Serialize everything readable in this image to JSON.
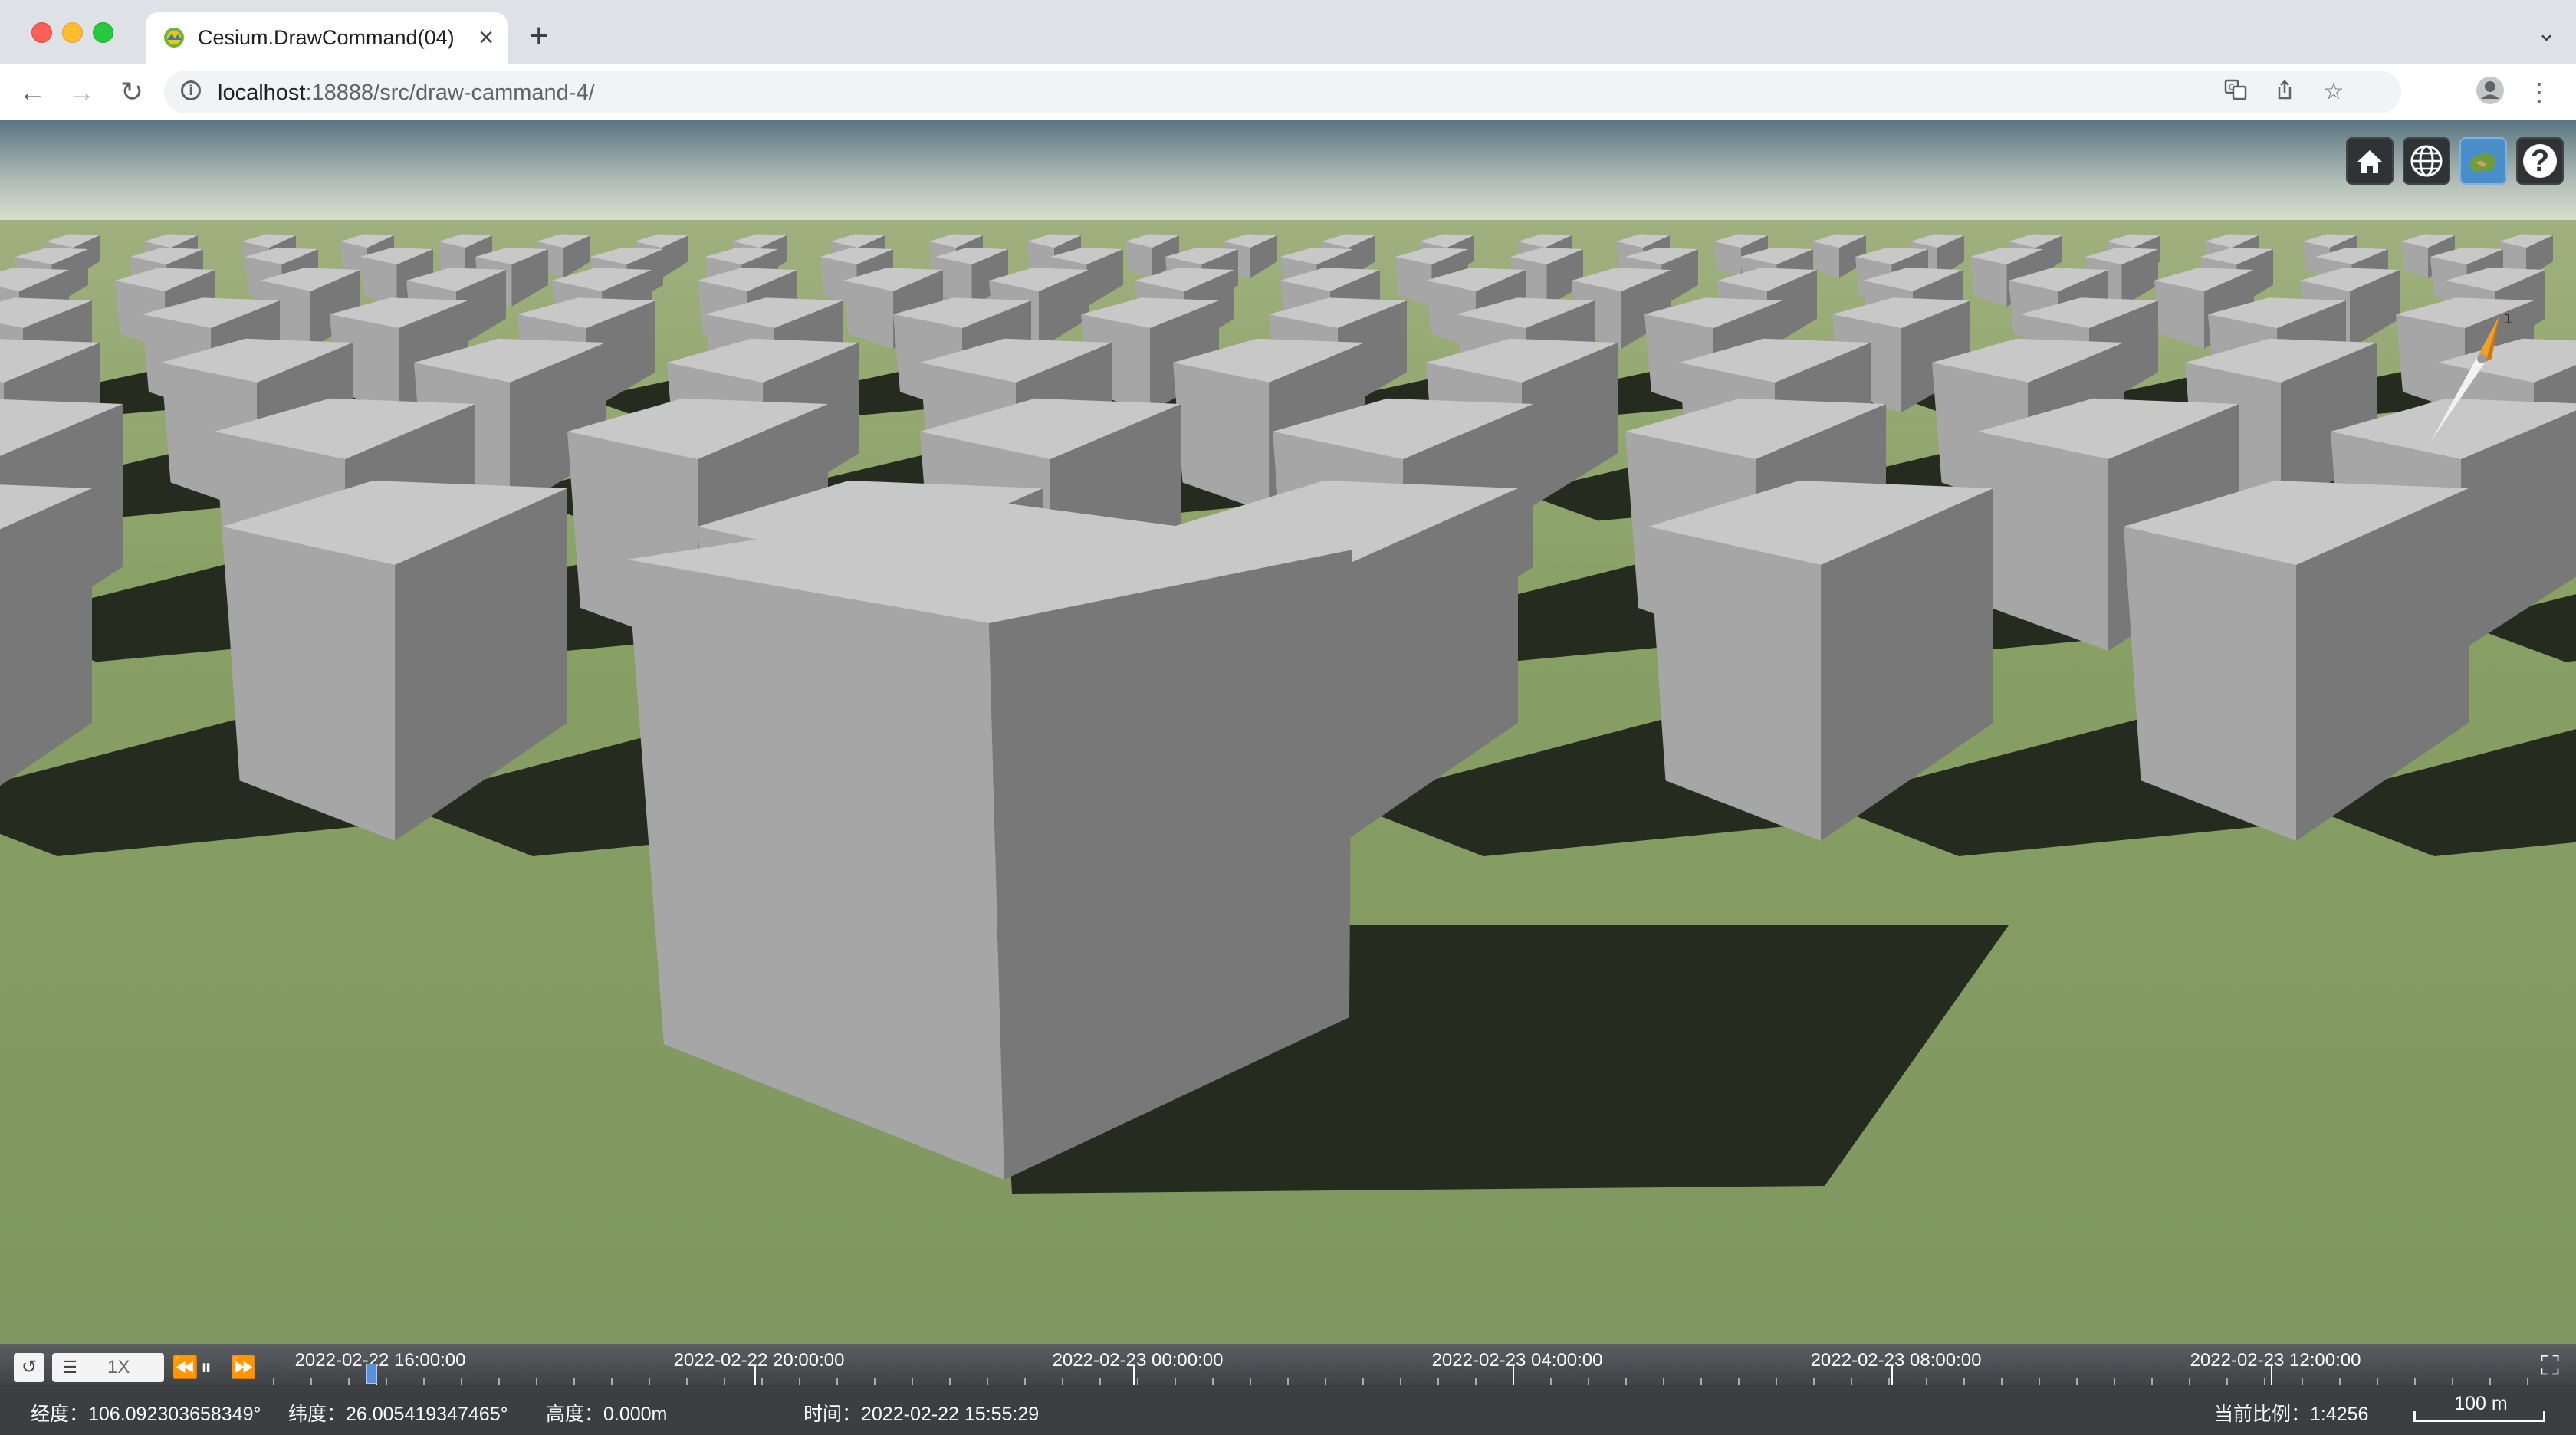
{
  "browser": {
    "tab_title": "Cesium.DrawCommand(04)",
    "url_host": "localhost",
    "url_rest": ":18888/src/draw-cammand-4/"
  },
  "cesium_toolbar": {
    "buttons": [
      {
        "name": "home-button"
      },
      {
        "name": "scene-mode-button"
      },
      {
        "name": "base-layer-picker-button"
      },
      {
        "name": "navigation-help-button",
        "label": "?"
      }
    ]
  },
  "animation": {
    "speed": "1X"
  },
  "timeline": {
    "labels": [
      "2022-02-22 16:00:00",
      "2022-02-22 20:00:00",
      "2022-02-23 00:00:00",
      "2022-02-23 04:00:00",
      "2022-02-23 08:00:00",
      "2022-02-23 12:00:00"
    ]
  },
  "status": {
    "longitude": "经度：106.092303658349°",
    "latitude": "纬度：26.005419347465°",
    "height": "高度：0.000m",
    "time": "时间：2022-02-22 15:55:29",
    "scale_ratio": "当前比例：1:4256",
    "scale_bar": "100 m"
  },
  "colors": {
    "sky_top": "#5a7582",
    "horizon": "#d6dcc4",
    "ground": "#7f9660",
    "shadow": "#262b1f",
    "box_top": "#c8c8c8",
    "box_left": "#a6a6a6",
    "box_right": "#787878"
  }
}
